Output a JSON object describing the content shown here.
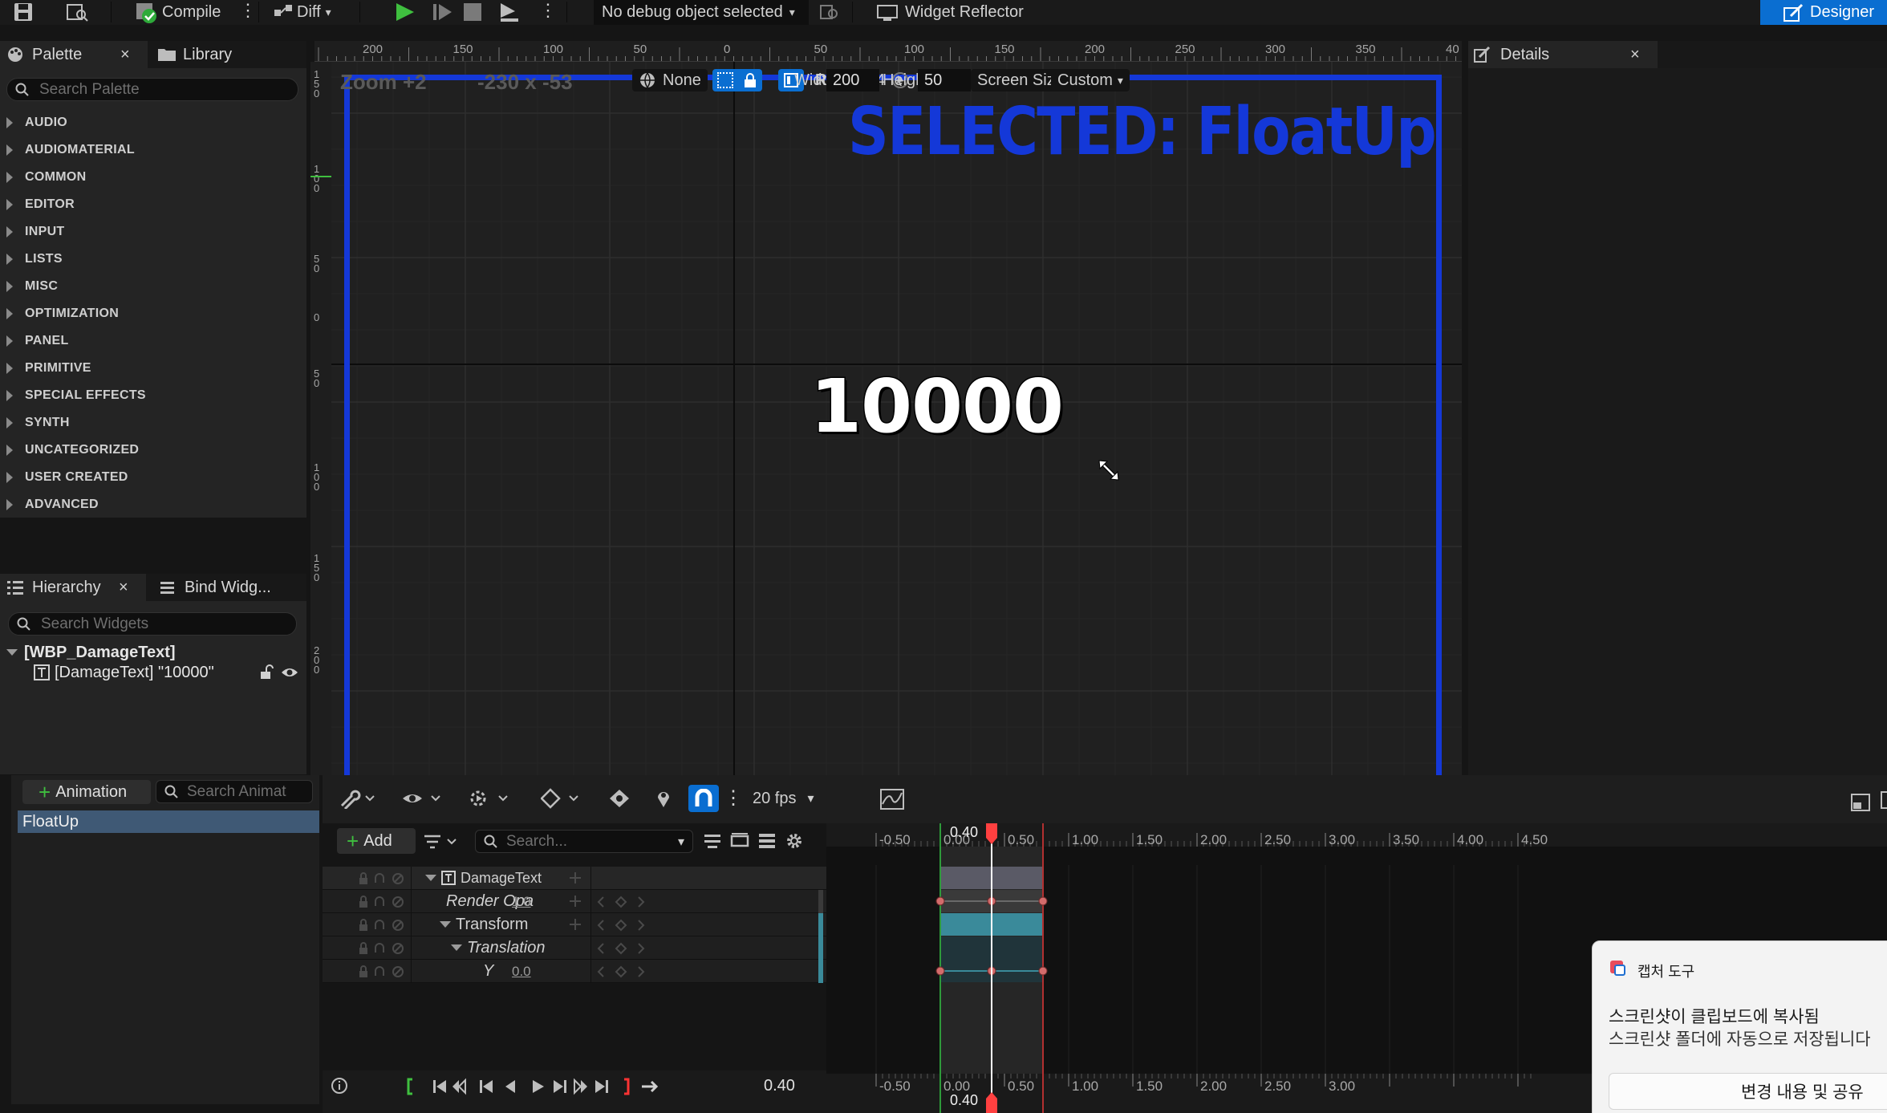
{
  "toolbar": {
    "compile_label": "Compile",
    "diff_label": "Diff",
    "debug_object": "No debug object selected",
    "widget_reflector": "Widget Reflector",
    "designer_label": "Designer"
  },
  "palette": {
    "tab_label": "Palette",
    "library_tab": "Library",
    "search_placeholder": "Search Palette",
    "categories": [
      "AUDIO",
      "AUDIOMATERIAL",
      "COMMON",
      "EDITOR",
      "INPUT",
      "LISTS",
      "MISC",
      "OPTIMIZATION",
      "PANEL",
      "PRIMITIVE",
      "SPECIAL EFFECTS",
      "SYNTH",
      "UNCATEGORIZED",
      "USER CREATED",
      "ADVANCED"
    ]
  },
  "hierarchy": {
    "tab_label": "Hierarchy",
    "bind_tab": "Bind Widg...",
    "search_placeholder": "Search Widgets",
    "root": "[WBP_DamageText]",
    "child": "[DamageText] \"10000\""
  },
  "viewport": {
    "zoom": "Zoom +2",
    "coords": "-230 x -53",
    "locale": "None",
    "r_button": "R",
    "grid_size": "4",
    "screen_size": "Screen Size",
    "custom": "Custom",
    "width_label": "Width",
    "width_value": "200",
    "height_label": "Height",
    "height_value": "50",
    "selected_banner": "SELECTED: FloatUp",
    "damage_text": "10000",
    "ruler_h": [
      "200",
      "150",
      "100",
      "50",
      "0",
      "50",
      "100",
      "150",
      "200",
      "250",
      "300",
      "350",
      "40"
    ],
    "ruler_v": [
      "1\n5\n0",
      "1\n0\n0",
      "5\n0",
      "0",
      "5\n0",
      "1\n0\n0",
      "1\n5\n0",
      "2\n0\n0"
    ]
  },
  "details": {
    "tab_label": "Details"
  },
  "animations": {
    "add_label": "Animation",
    "search_placeholder": "Search Animat",
    "items": [
      "FloatUp"
    ]
  },
  "sequencer": {
    "fps": "20 fps",
    "add_label": "Add",
    "search_placeholder": "Search...",
    "tracks": [
      {
        "label": "DamageText",
        "value": ""
      },
      {
        "label": "Render Opa",
        "value": "1.0"
      },
      {
        "label": "Transform",
        "value": ""
      },
      {
        "label": "Translation",
        "value": ""
      },
      {
        "label": "Y",
        "value": "0.0"
      }
    ],
    "current_time": "0.40",
    "playhead": "0.40",
    "ticks_top": [
      "-0.50",
      "0.00",
      "0.50",
      "1.00",
      "1.50",
      "2.00",
      "2.50",
      "3.00",
      "3.50",
      "4.00",
      "4.50"
    ],
    "ticks_bottom": [
      "-0.50",
      "0.00",
      "0.50",
      "1.00",
      "1.50",
      "2.00",
      "2.50",
      "3.00"
    ]
  },
  "toast": {
    "app_name": "캡처 도구",
    "line1": "스크린샷이 클립보드에 복사됨",
    "line2": "스크린샷 폴더에 자동으로 저장됩니다",
    "button": "변경 내용 및 공유"
  },
  "colors": {
    "accent": "#0a6ed1",
    "selection_blue": "#1438d8",
    "keyframe": "#d36c6c",
    "playhead": "#ff4040",
    "track_teal": "#3a8a9a"
  }
}
